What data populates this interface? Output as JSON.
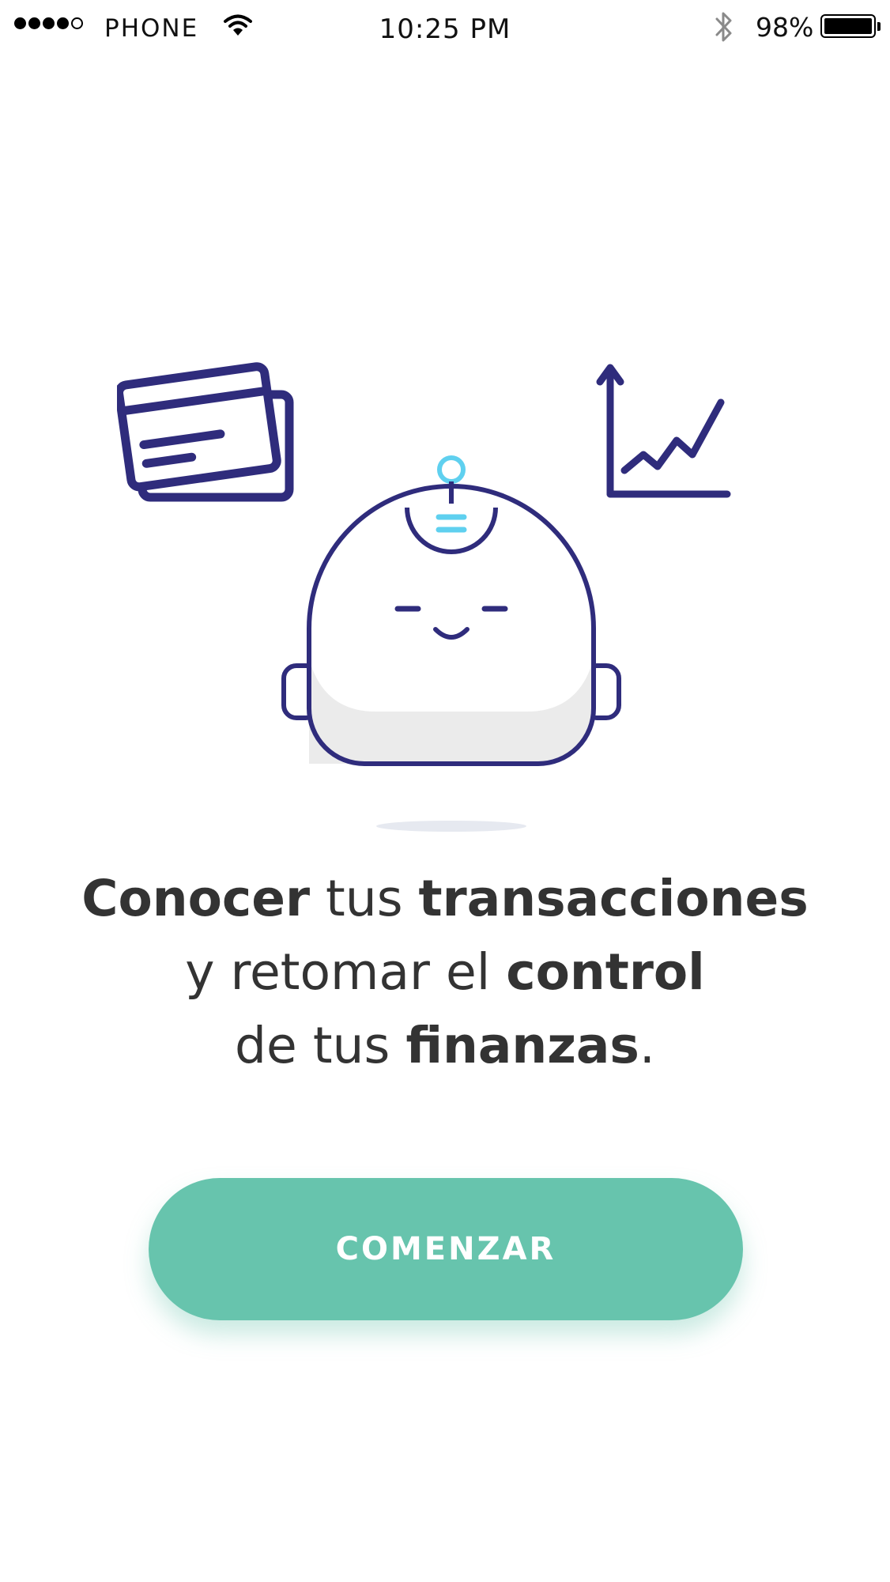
{
  "status_bar": {
    "carrier": "PHONE",
    "time": "10:25 PM",
    "battery_percent": "98%",
    "signal_strength": 4,
    "signal_max": 5,
    "icons": [
      "wifi-icon",
      "bluetooth-icon",
      "battery-icon"
    ]
  },
  "illustration": {
    "icons": [
      "credit-cards-icon",
      "growth-chart-icon",
      "robot-mascot-icon"
    ],
    "colors": {
      "outline": "#2f2c7c",
      "antenna": "#5fd0ef",
      "face_fill": "#ffffff",
      "face_shade": "#ebebeb"
    }
  },
  "headline": {
    "line1_bold_a": "Conocer",
    "line1_regular": " tus ",
    "line1_bold_b": "transacciones",
    "line2_regular": "y retomar el ",
    "line2_bold": "control",
    "line3_regular": "de tus ",
    "line3_bold": "finanzas",
    "line3_end": "."
  },
  "cta": {
    "label": "COMENZAR",
    "color": "#67c4ad"
  }
}
